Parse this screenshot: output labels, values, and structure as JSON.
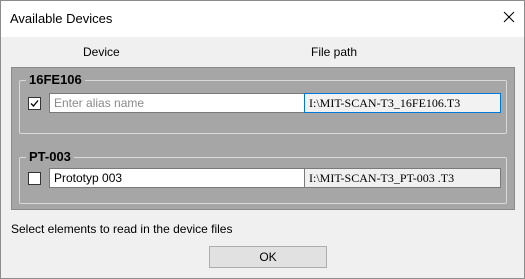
{
  "window": {
    "title": "Available Devices",
    "close_icon": "close-icon"
  },
  "columns": {
    "device": "Device",
    "file_path": "File path"
  },
  "devices": [
    {
      "name": "16FE106",
      "checked": true,
      "alias_value": "",
      "alias_placeholder": "Enter alias name",
      "alias_display": "Enter alias name",
      "file_path": "I:\\MIT-SCAN-T3_16FE106.T3"
    },
    {
      "name": "PT-003",
      "checked": false,
      "alias_value": "Prototyp 003",
      "alias_placeholder": "Enter alias name",
      "alias_display": "Prototyp 003",
      "file_path": "I:\\MIT-SCAN-T3_PT-003 .T3"
    }
  ],
  "hint": "Select elements to read in the device files",
  "buttons": {
    "ok": "OK"
  },
  "colors": {
    "panel_bg": "#a6a6a6",
    "dialog_bg": "#f0f0f0",
    "focus_border": "#0078d7"
  }
}
